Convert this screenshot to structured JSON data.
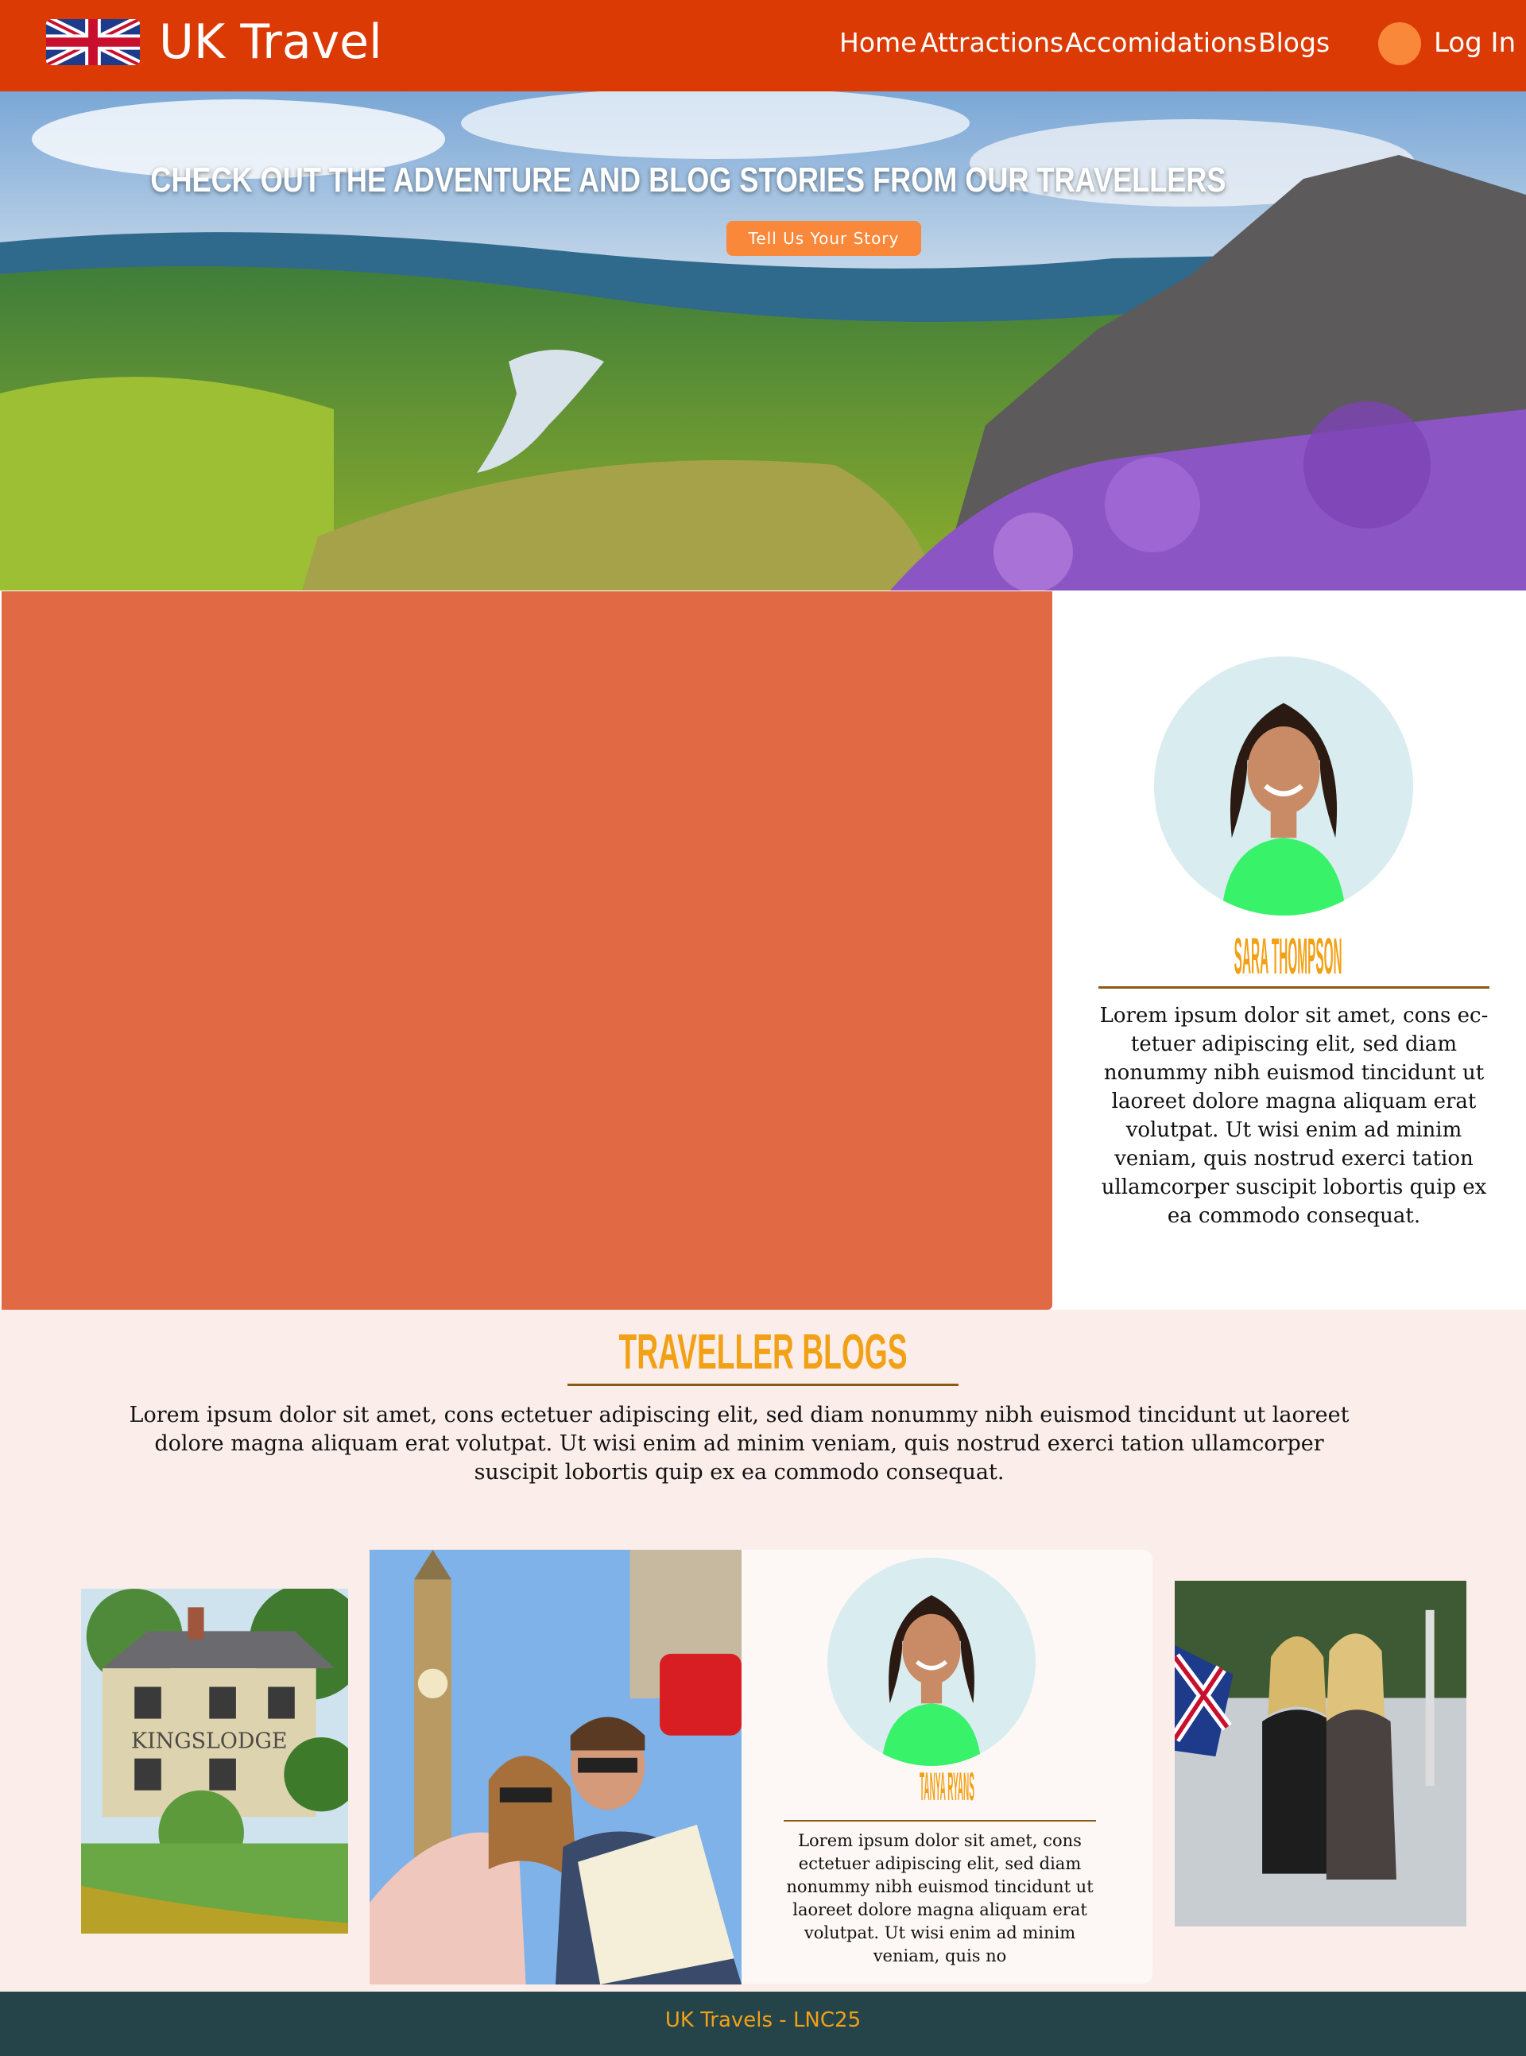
{
  "header": {
    "brand": "UK Travel",
    "flag_icon": "union-jack-flag-icon",
    "nav": {
      "home": "Home",
      "attractions": "Attractions",
      "accommodations": "Accomidations",
      "blogs": "Blogs"
    },
    "login_label": "Log In"
  },
  "hero": {
    "title": "CHECK OUT THE ADVENTURE AND BLOG STORIES FROM OUR TRAVELLERS",
    "cta_label": "Tell Us Your Story"
  },
  "featured": {
    "name": "SARA THOMPSON",
    "bio": "Lorem ipsum dolor sit amet, cons ec-tetuer adipiscing elit, sed diam nonummy nibh euismod tincidunt ut laoreet dolore magna aliquam erat volutpat. Ut wisi enim ad minim veniam, quis nostrud exerci tation ullamcorper suscipit lobortis quip ex ea commodo consequat."
  },
  "blogs": {
    "title": "TRAVELLER BLOGS",
    "description": "Lorem ipsum dolor sit amet, cons ectetuer adipiscing elit, sed diam nonummy nibh euismod tincidunt ut laoreet dolore magna aliquam erat volutpat. Ut wisi enim ad minim veniam, quis nostrud exerci tation ullamcorper suscipit lobortis quip ex ea commodo consequat.",
    "card": {
      "name": "TANYA RYANS",
      "bio": "Lorem ipsum dolor sit amet, cons ectetuer adipiscing elit, sed diam nonummy nibh euismod tincidunt ut laoreet dolore magna aliquam erat volutpat. Ut wisi enim ad minim veniam, quis no"
    },
    "photo_sign": "KINGSLODGE"
  },
  "footer": {
    "text": "UK Travels - LNC25"
  },
  "colors": {
    "header_bg": "#dc3a04",
    "accent_orange": "#f9883a",
    "heading_gold": "#f2a116",
    "featured_block": "#e16a44",
    "blogs_bg": "#fbeeea",
    "footer_bg": "#24444a"
  }
}
